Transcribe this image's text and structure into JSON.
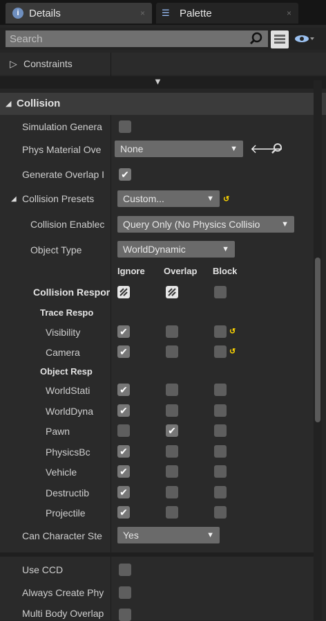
{
  "tabs": {
    "details": {
      "label": "Details",
      "icon": "info-icon"
    },
    "palette": {
      "label": "Palette",
      "icon": "palette-icon"
    },
    "close": "×"
  },
  "search": {
    "placeholder": "Search"
  },
  "constraints": {
    "label": "Constraints"
  },
  "collision": {
    "header": "Collision"
  },
  "props": {
    "simulation_generates": "Simulation Genera",
    "phys_material_override": {
      "label": "Phys Material Ove",
      "value": "None"
    },
    "generate_overlap": "Generate Overlap I",
    "collision_presets": {
      "label": "Collision Presets",
      "value": "Custom..."
    },
    "collision_enabled": {
      "label": "Collision Enablec",
      "value": "Query Only (No Physics Collisio"
    },
    "object_type": {
      "label": "Object Type",
      "value": "WorldDynamic"
    },
    "columns": {
      "ignore": "Ignore",
      "overlap": "Overlap",
      "block": "Block"
    },
    "collision_responses": "Collision Respor",
    "trace_responses": "Trace Respo",
    "object_responses": "Object Resp",
    "traces": [
      {
        "label": "Visibility",
        "ignore": true,
        "overlap": false,
        "block": false,
        "reset": true
      },
      {
        "label": "Camera",
        "ignore": true,
        "overlap": false,
        "block": false,
        "reset": true
      }
    ],
    "objects": [
      {
        "label": "WorldStati",
        "ignore": true,
        "overlap": false,
        "block": false
      },
      {
        "label": "WorldDyna",
        "ignore": true,
        "overlap": false,
        "block": false
      },
      {
        "label": "Pawn",
        "ignore": false,
        "overlap": true,
        "block": false
      },
      {
        "label": "PhysicsBc",
        "ignore": true,
        "overlap": false,
        "block": false
      },
      {
        "label": "Vehicle",
        "ignore": true,
        "overlap": false,
        "block": false
      },
      {
        "label": "Destructib",
        "ignore": true,
        "overlap": false,
        "block": false
      },
      {
        "label": "Projectile",
        "ignore": true,
        "overlap": false,
        "block": false
      }
    ],
    "can_character_step": {
      "label": "Can Character Ste",
      "value": "Yes"
    },
    "use_ccd": "Use CCD",
    "always_create_physics": "Always Create Phy",
    "multi_body_overlap": "Multi Body Overlap"
  },
  "colors": {
    "accent_reset": "#ffd700",
    "panel": "#262626",
    "check": "#777777"
  }
}
